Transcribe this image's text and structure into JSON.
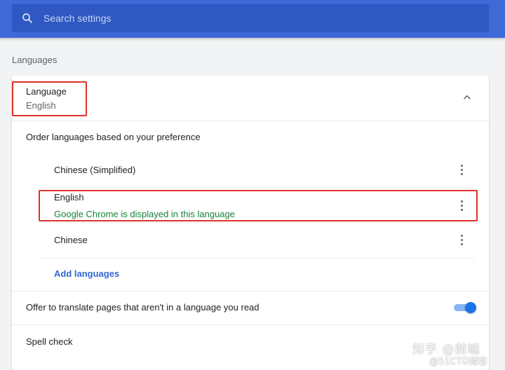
{
  "search": {
    "placeholder": "Search settings",
    "icon": "search-icon"
  },
  "section_title": "Languages",
  "language_panel": {
    "title": "Language",
    "current": "English",
    "expanded": true,
    "order_label": "Order languages based on your preference",
    "languages": [
      {
        "name": "Chinese (Simplified)",
        "note": ""
      },
      {
        "name": "English",
        "note": "Google Chrome is displayed in this language"
      },
      {
        "name": "Chinese",
        "note": ""
      }
    ],
    "add_languages": "Add languages"
  },
  "translate": {
    "label": "Offer to translate pages that aren't in a language you read",
    "enabled": true
  },
  "spell_check": {
    "label": "Spell check"
  },
  "watermark": {
    "line1": "知乎 @前端",
    "line2": "@51CTO博客"
  },
  "colors": {
    "header": "#3e6ad7",
    "search_box": "#2f58c2",
    "link": "#3367d6",
    "note_green": "#188038",
    "toggle_on": "#1a73e8",
    "annotation_red": "#e0312a"
  }
}
